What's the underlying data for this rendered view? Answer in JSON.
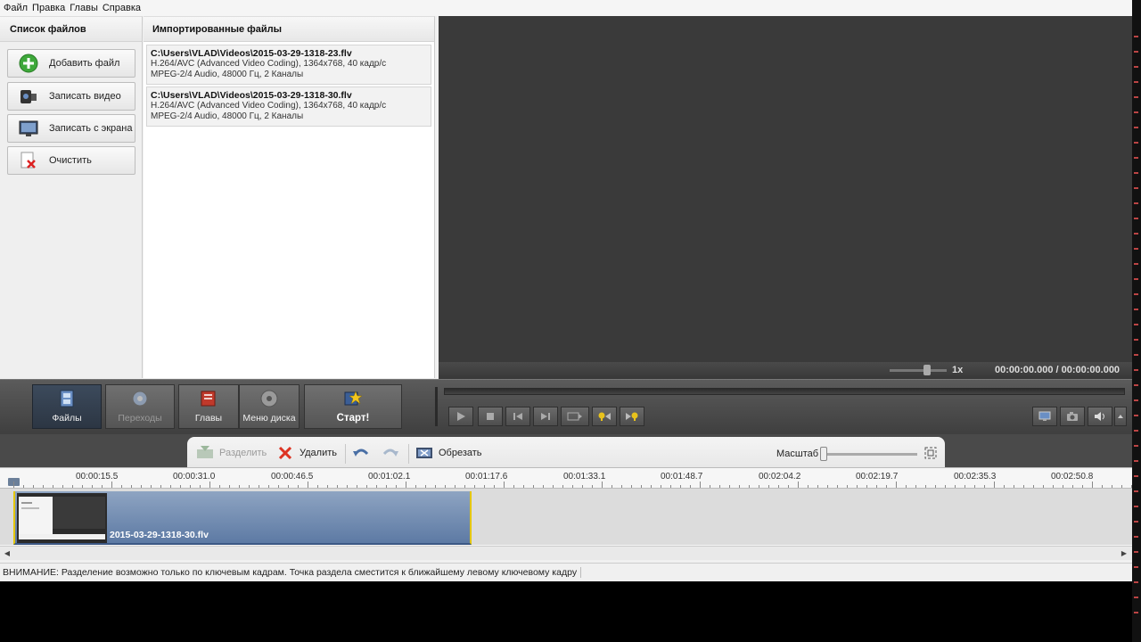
{
  "menu": [
    "Файл",
    "Правка",
    "Главы",
    "Справка"
  ],
  "left_panel": {
    "title": "Список файлов",
    "buttons": [
      {
        "label": "Добавить файл",
        "icon": "add-icon"
      },
      {
        "label": "Записать видео",
        "icon": "camera-icon"
      },
      {
        "label": "Записать с экрана",
        "icon": "screen-record-icon"
      },
      {
        "label": "Очистить",
        "icon": "clear-icon"
      }
    ]
  },
  "files_panel": {
    "title": "Импортированные файлы",
    "files": [
      {
        "path": "C:\\Users\\VLAD\\Videos\\2015-03-29-1318-23.flv",
        "video": "H.264/AVC (Advanced Video Coding), 1364x768, 40 кадр/с",
        "audio": "MPEG-2/4 Audio, 48000 Гц, 2 Каналы"
      },
      {
        "path": "C:\\Users\\VLAD\\Videos\\2015-03-29-1318-30.flv",
        "video": "H.264/AVC (Advanced Video Coding), 1364x768, 40 кадр/с",
        "audio": "MPEG-2/4 Audio, 48000 Гц, 2 Каналы"
      }
    ]
  },
  "preview": {
    "speed": "1x",
    "time": "00:00:00.000 / 00:00:00.000"
  },
  "toolbar": {
    "files": "Файлы",
    "transitions": "Переходы",
    "chapters": "Главы",
    "disc_menu": "Меню диска",
    "start": "Старт!"
  },
  "timeline_toolbar": {
    "split": "Разделить",
    "delete": "Удалить",
    "trim": "Обрезать",
    "zoom": "Масштаб"
  },
  "ruler": [
    "00:00:15.5",
    "00:00:31.0",
    "00:00:46.5",
    "00:01:02.1",
    "00:01:17.6",
    "00:01:33.1",
    "00:01:48.7",
    "00:02:04.2",
    "00:02:19.7",
    "00:02:35.3",
    "00:02:50.8"
  ],
  "clip": {
    "name": "2015-03-29-1318-30.flv"
  },
  "status": "ВНИМАНИЕ: Разделение возможно только по ключевым кадрам. Точка раздела сместится к ближайшему левому ключевому кадру",
  "colors": {
    "accent": "#e4c600",
    "clip": "#5d7aa4",
    "preview": "#3a3a3a"
  }
}
